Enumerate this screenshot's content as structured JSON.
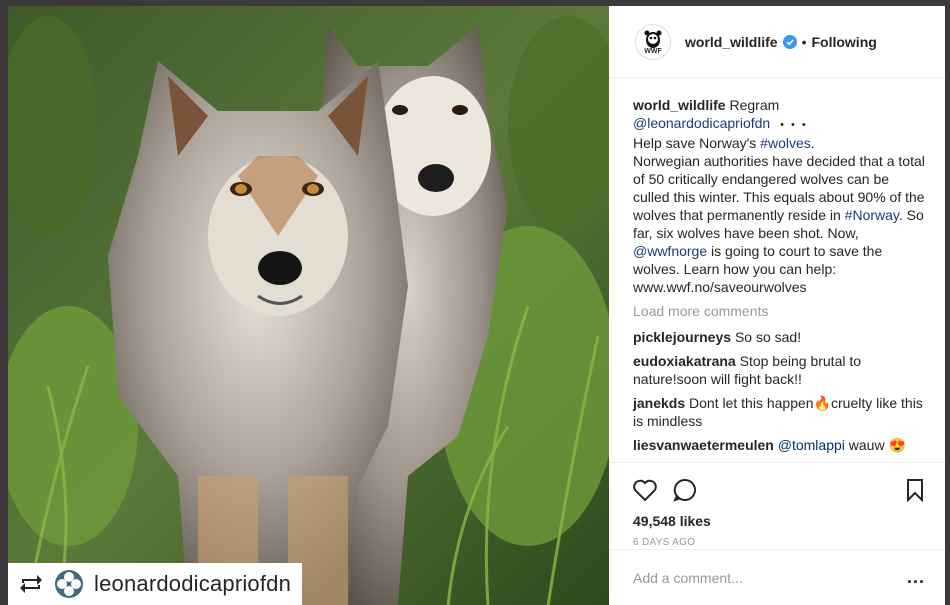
{
  "post": {
    "username": "world_wildlife",
    "separator": "•",
    "follow_state": "Following",
    "avatar_text": "WWF"
  },
  "caption": {
    "author": "world_wildlife",
    "regram_word": "Regram",
    "regram_source": "@leonardodicapriofdn",
    "ellipsis": "• • •",
    "line1_pre": "Help save Norway's ",
    "tag_wolves": "#wolves",
    "line1_post": ".",
    "body1": "Norwegian authorities have decided that a total of 50 critically endangered wolves can be culled this winter. This equals about 90% of the wolves that permanently reside in ",
    "tag_norway": "#Norway",
    "body2": ". So far, six wolves have been shot. Now, ",
    "mention_wwf": "@wwfnorge",
    "body3": " is going to court to save the wolves. Learn how you can help: www.wwf.no/saveourwolves"
  },
  "load_more_label": "Load more comments",
  "comments": [
    {
      "user": "picklejourneys",
      "text": "So so sad!"
    },
    {
      "user": "eudoxiakatrana",
      "text": "Stop being brutal to nature!soon will fight back!!"
    },
    {
      "user": "janekds",
      "text": "Dont let this happen🔥cruelty like this is mindless"
    },
    {
      "user": "liesvanwaetermeulen",
      "mention": "@tomlappi",
      "text": " wauw 😍"
    }
  ],
  "likes": "49,548 likes",
  "timestamp": "6 DAYS AGO",
  "comment_input": {
    "placeholder": "Add a comment...",
    "more": "..."
  },
  "regram_overlay": {
    "account": "leonardodicapriofdn"
  },
  "colors": {
    "verified": "#3897f0",
    "link": "#003569",
    "muted": "#999999"
  }
}
